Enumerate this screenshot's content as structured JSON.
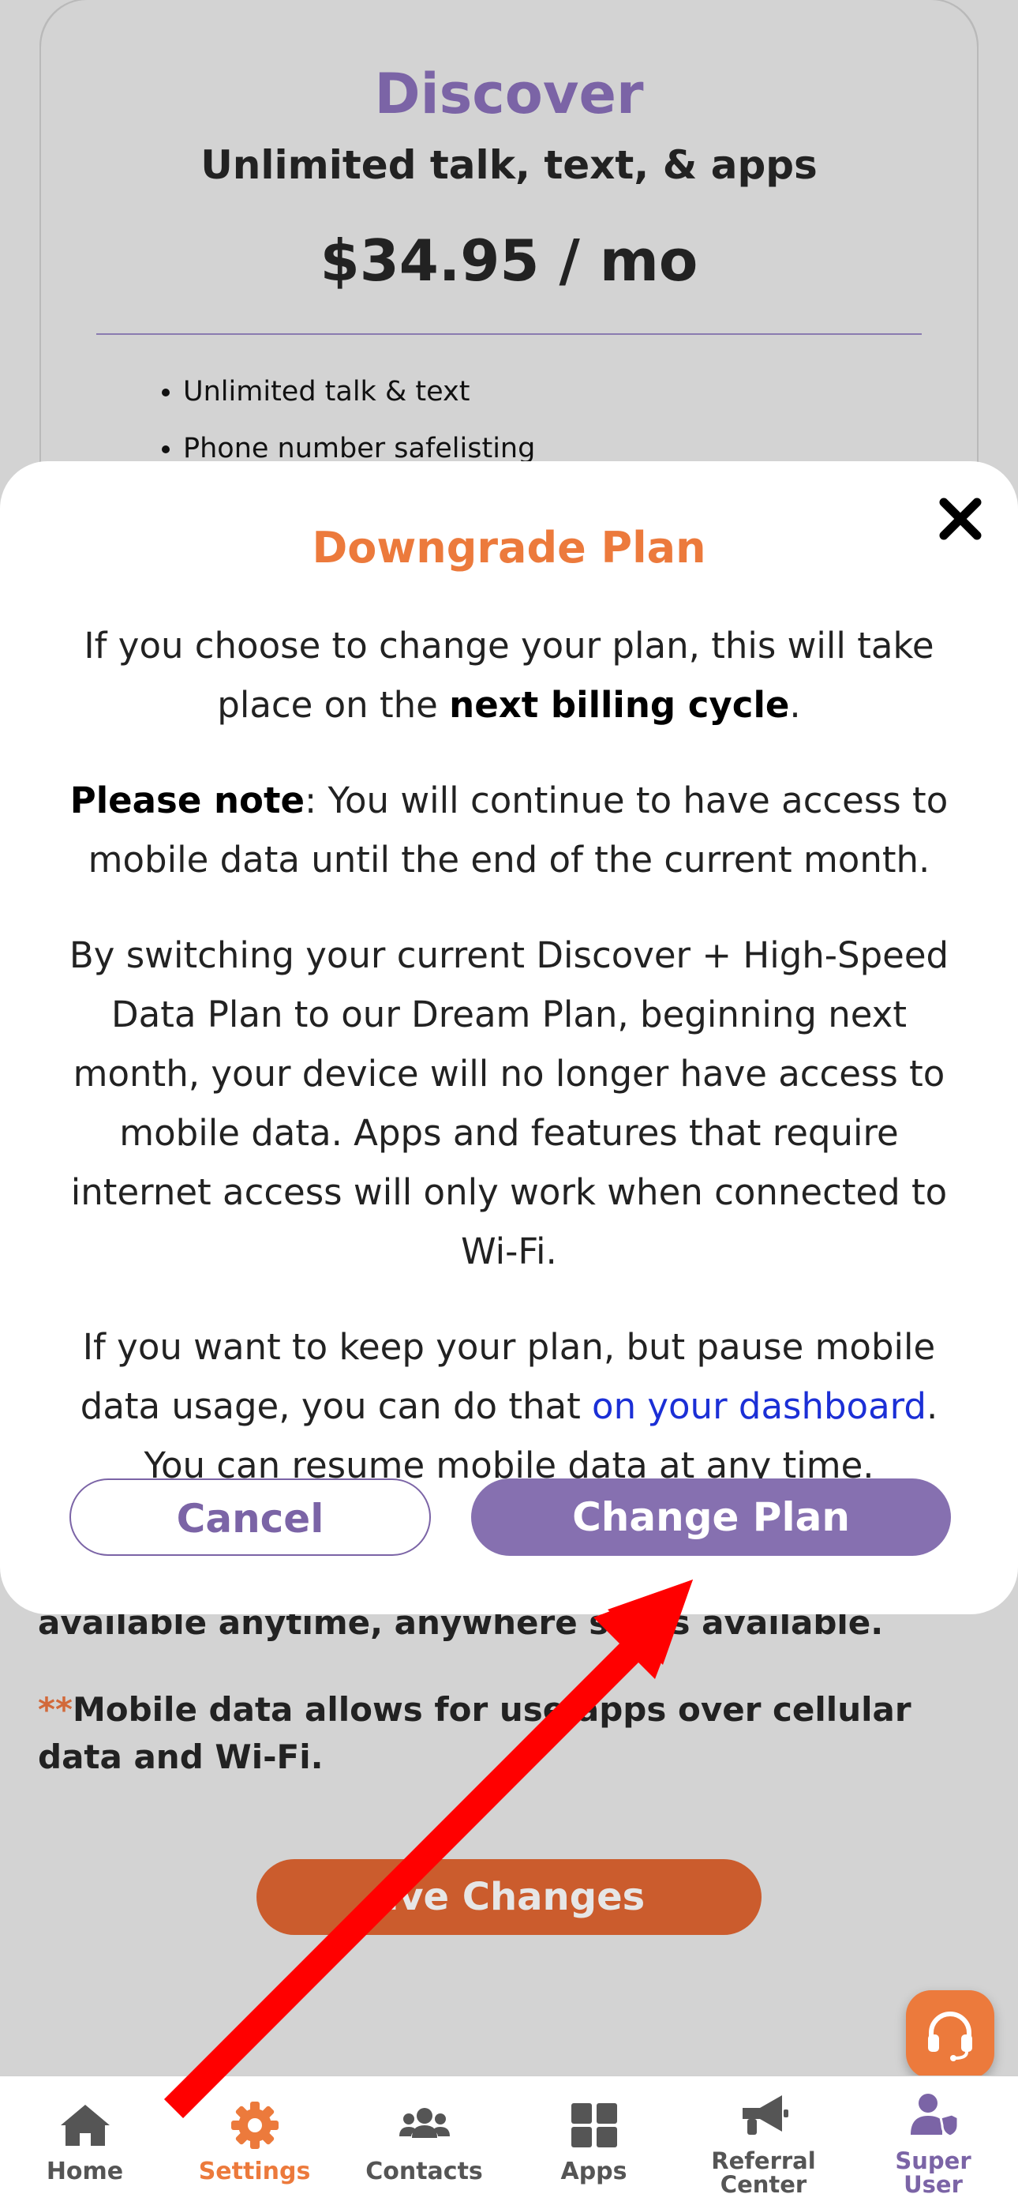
{
  "plan_card": {
    "name": "Discover",
    "tagline": "Unlimited talk, text, & apps",
    "price": "$34.95 / mo",
    "features": [
      "Unlimited talk & text",
      "Phone number safelisting"
    ]
  },
  "behind_text": {
    "line1": "available anytime, anywhere ser      is available.",
    "line2_stars": "**",
    "line2": "Mobile data allows for use     apps over cellular data and Wi-Fi."
  },
  "save_button": "ave Changes",
  "modal": {
    "title": "Downgrade Plan",
    "p1_before": "If you choose to change your plan, this will take place on the ",
    "p1_strong": "next billing cycle",
    "p1_after": ".",
    "p2_strong": "Please note",
    "p2_after": ": You will continue to have access to mobile data until the end of the current month.",
    "p3": "By switching your current Discover + High-Speed Data Plan to our Dream Plan, beginning next month, your device will no longer have access to mobile data. Apps and features that require internet access will only work when connected to Wi-Fi.",
    "p4_before": "If you want to keep your plan, but pause mobile data usage, you can do that ",
    "p4_link": "on your dashboard",
    "p4_after": ". You can resume mobile data at any time.",
    "cancel_label": "Cancel",
    "change_label": "Change Plan"
  },
  "nav": {
    "items": [
      {
        "label": "Home",
        "icon": "home-icon"
      },
      {
        "label": "Settings",
        "icon": "gear-icon",
        "active": true
      },
      {
        "label": "Contacts",
        "icon": "contacts-icon"
      },
      {
        "label": "Apps",
        "icon": "apps-grid-icon"
      },
      {
        "label": "Referral Center",
        "icon": "megaphone-icon"
      },
      {
        "label": "Super User",
        "icon": "super-user-icon"
      }
    ]
  },
  "colors": {
    "accent_orange": "#ec7a3c",
    "accent_purple": "#7b64a6",
    "link_blue": "#1b2fd6",
    "annotation_red": "#ff0000"
  }
}
